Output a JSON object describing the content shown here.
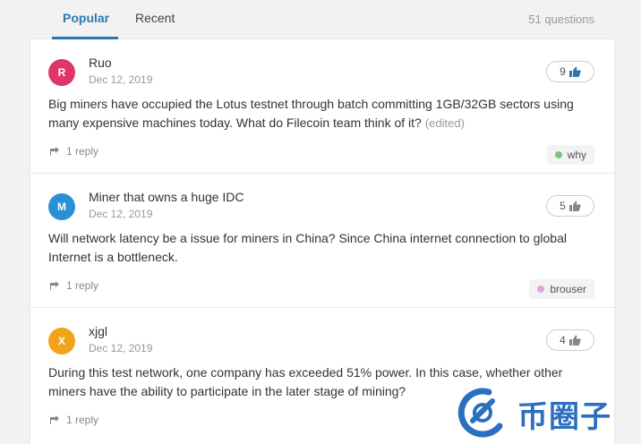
{
  "tabs": [
    {
      "label": "Popular",
      "active": true
    },
    {
      "label": "Recent",
      "active": false
    }
  ],
  "question_count": "51 questions",
  "colors": {
    "accent": "#2a7ab0",
    "watermark": "#2b6fbf"
  },
  "questions": [
    {
      "avatar_letter": "R",
      "avatar_color": "#e0356b",
      "author": "Ruo",
      "date": "Dec 12, 2019",
      "likes": "9",
      "liked": true,
      "text": "Big miners have occupied the Lotus testnet through batch committing 1GB/32GB sectors using many expensive machines today. What do Filecoin team think of it?",
      "edited": "(edited)",
      "replies": "1 reply",
      "tag": "why",
      "tag_color": "#7dc67d"
    },
    {
      "avatar_letter": "M",
      "avatar_color": "#2b8fd6",
      "author": "Miner that owns a huge IDC",
      "date": "Dec 12, 2019",
      "likes": "5",
      "liked": false,
      "text": "Will network latency be a issue for miners in China? Since China internet connection to global Internet is a bottleneck.",
      "edited": "",
      "replies": "1 reply",
      "tag": "brouser",
      "tag_color": "#e6a3d6"
    },
    {
      "avatar_letter": "X",
      "avatar_color": "#f2a31b",
      "author": "xjgl",
      "date": "Dec 12, 2019",
      "likes": "4",
      "liked": false,
      "text": "During this test network, one company has exceeded 51% power. In this case, whether other miners have the ability to participate in the later stage of mining?",
      "edited": "",
      "replies": "1 reply",
      "tag": "",
      "tag_color": ""
    }
  ],
  "watermark": {
    "text": "币圈子",
    "icon": "watermark-logo-icon"
  }
}
